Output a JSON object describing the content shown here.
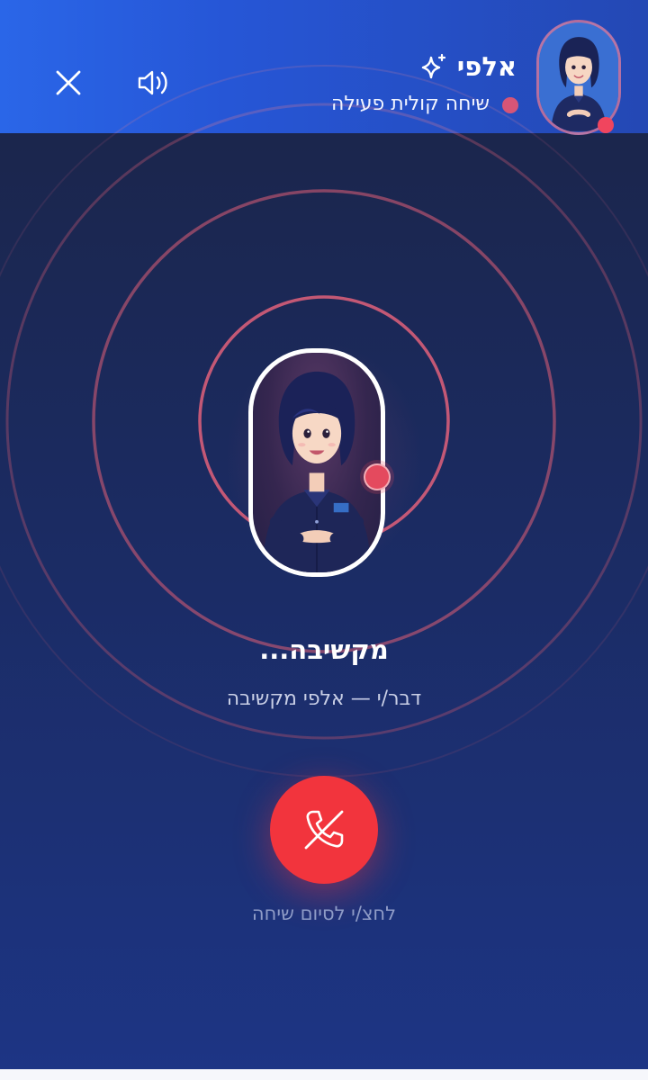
{
  "header": {
    "agent_name": "אלפי",
    "status_text": "שיחה קולית פעילה",
    "icons": {
      "sparkle": "sparkle-icon",
      "speaker": "speaker-icon",
      "close": "close-icon",
      "status_dot": "status-dot",
      "avatar": "avatar"
    }
  },
  "call": {
    "state_title": "מקשיבה...",
    "state_subtitle": "דבר/י — אלפי מקשיבה",
    "end_call_hint": "לחצ/י לסיום שיחה",
    "end_call_icon": "phone-hangup-icon"
  },
  "colors": {
    "header_start": "#2a66e8",
    "header_end": "#2448b4",
    "background_top": "#1b2445",
    "background_bottom": "#1d3585",
    "ring_accent": "#e0607a",
    "end_call_red": "#f2343d",
    "status_dot": "#d65577"
  }
}
